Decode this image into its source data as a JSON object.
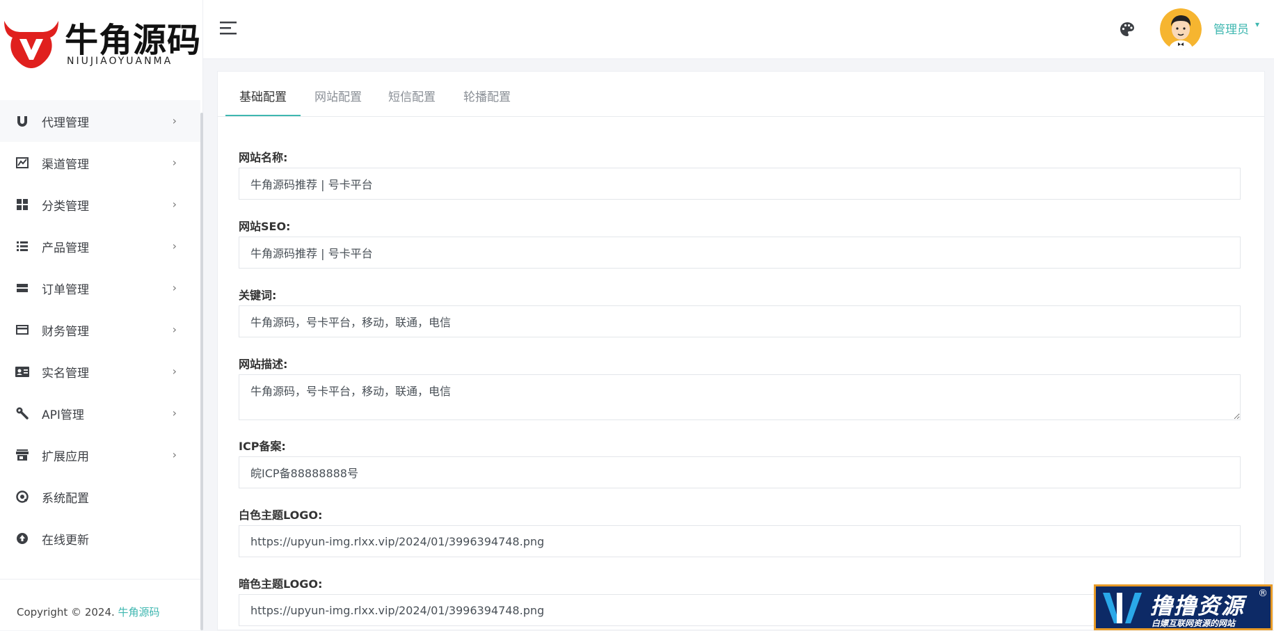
{
  "brand": {
    "name_cn": "牛角源码",
    "name_en": "NIUJIAOYUANMA",
    "color": "#e0201e"
  },
  "accent_color": "#3fb7b0",
  "sidebar": {
    "items": [
      {
        "label": "代理管理",
        "icon": "magnet-icon",
        "has_children": true
      },
      {
        "label": "渠道管理",
        "icon": "chart-icon",
        "has_children": true
      },
      {
        "label": "分类管理",
        "icon": "grid-icon",
        "has_children": true
      },
      {
        "label": "产品管理",
        "icon": "list-icon",
        "has_children": true
      },
      {
        "label": "订单管理",
        "icon": "order-icon",
        "has_children": true
      },
      {
        "label": "财务管理",
        "icon": "credit-card-icon",
        "has_children": true
      },
      {
        "label": "实名管理",
        "icon": "id-card-icon",
        "has_children": true
      },
      {
        "label": "API管理",
        "icon": "wrench-icon",
        "has_children": true
      },
      {
        "label": "扩展应用",
        "icon": "store-icon",
        "has_children": true
      },
      {
        "label": "系统配置",
        "icon": "settings-icon",
        "has_children": false
      },
      {
        "label": "在线更新",
        "icon": "upload-icon",
        "has_children": false
      }
    ],
    "chevron": "›"
  },
  "footer": {
    "copyright": "Copyright © 2024. ",
    "link": "牛角源码"
  },
  "header": {
    "user_name": "管理员",
    "caret": "▾"
  },
  "tabs": [
    {
      "label": "基础配置",
      "active": true
    },
    {
      "label": "网站配置",
      "active": false
    },
    {
      "label": "短信配置",
      "active": false
    },
    {
      "label": "轮播配置",
      "active": false
    }
  ],
  "form": {
    "fields": [
      {
        "label": "网站名称:",
        "value": "牛角源码推荐 | 号卡平台"
      },
      {
        "label": "网站SEO:",
        "value": "牛角源码推荐 | 号卡平台"
      },
      {
        "label": "关键词:",
        "value": "牛角源码，号卡平台，移动，联通，电信"
      },
      {
        "label": "网站描述:",
        "value": "牛角源码，号卡平台，移动，联通，电信"
      },
      {
        "label": "ICP备案:",
        "value": "皖ICP备88888888号"
      },
      {
        "label": "白色主题LOGO:",
        "value": "https://upyun-img.rlxx.vip/2024/01/3996394748.png"
      },
      {
        "label": "暗色主题LOGO:",
        "value": "https://upyun-img.rlxx.vip/2024/01/3996394748.png"
      }
    ]
  },
  "watermark": {
    "title": "撸撸资源",
    "subtitle": "白嫖互联网资源的网站",
    "reg": "®"
  }
}
